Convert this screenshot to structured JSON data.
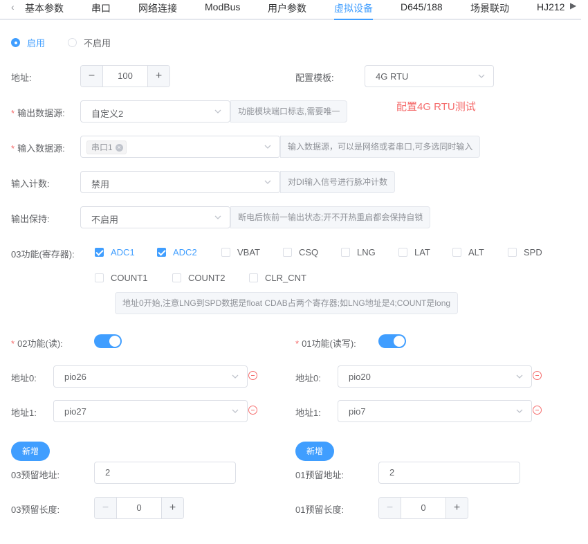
{
  "tabs": [
    "基本参数",
    "串口",
    "网络连接",
    "ModBus",
    "用户参数",
    "虚拟设备",
    "D645/188",
    "场景联动",
    "HJ212"
  ],
  "active_tab": "虚拟设备",
  "enable_radio": {
    "on": "启用",
    "off": "不启用"
  },
  "address": {
    "label": "地址:",
    "value": "100"
  },
  "config_template": {
    "label": "配置模板:",
    "value": "4G RTU"
  },
  "red_note": "配置4G RTU测试",
  "output_source": {
    "label": "输出数据源:",
    "value": "自定义2",
    "hint": "功能模块端口标志,需要唯一"
  },
  "input_source": {
    "label": "输入数据源:",
    "tag": "串口1",
    "hint": "输入数据源，可以是网络或者串口,可多选同时输入"
  },
  "input_count": {
    "label": "输入计数:",
    "value": "禁用",
    "hint": "对DI输入信号进行脉冲计数"
  },
  "output_hold": {
    "label": "输出保持:",
    "value": "不启用",
    "hint": "断电后恢前一输出状态;开不开热重启都会保持自锁"
  },
  "func03": {
    "label": "03功能(寄存器):",
    "options": [
      {
        "name": "ADC1",
        "checked": true
      },
      {
        "name": "ADC2",
        "checked": true
      },
      {
        "name": "VBAT",
        "checked": false
      },
      {
        "name": "CSQ",
        "checked": false
      },
      {
        "name": "LNG",
        "checked": false
      },
      {
        "name": "LAT",
        "checked": false
      },
      {
        "name": "ALT",
        "checked": false
      },
      {
        "name": "SPD",
        "checked": false
      },
      {
        "name": "COUNT1",
        "checked": false
      },
      {
        "name": "COUNT2",
        "checked": false
      },
      {
        "name": "CLR_CNT",
        "checked": false
      }
    ],
    "hint": "地址0开始,注意LNG到SPD数据是float CDAB占两个寄存器;如LNG地址是4;COUNT是long"
  },
  "func02": {
    "label": "02功能(读):",
    "addr0_label": "地址0:",
    "addr0": "pio26",
    "addr1_label": "地址1:",
    "addr1": "pio27",
    "add_label": "新增",
    "reserve_addr_label": "03预留地址:",
    "reserve_addr": "2",
    "reserve_len_label": "03预留长度:",
    "reserve_len": "0"
  },
  "func01": {
    "label": "01功能(读写):",
    "addr0_label": "地址0:",
    "addr0": "pio20",
    "addr1_label": "地址1:",
    "addr1": "pio7",
    "add_label": "新增",
    "reserve_addr_label": "01预留地址:",
    "reserve_addr": "2",
    "reserve_len_label": "01预留长度:",
    "reserve_len": "0"
  },
  "icons": {
    "stepper_minus": "−",
    "stepper_plus": "+",
    "tag_close": "×",
    "tab_prev": "‹",
    "tab_next": "▶"
  }
}
